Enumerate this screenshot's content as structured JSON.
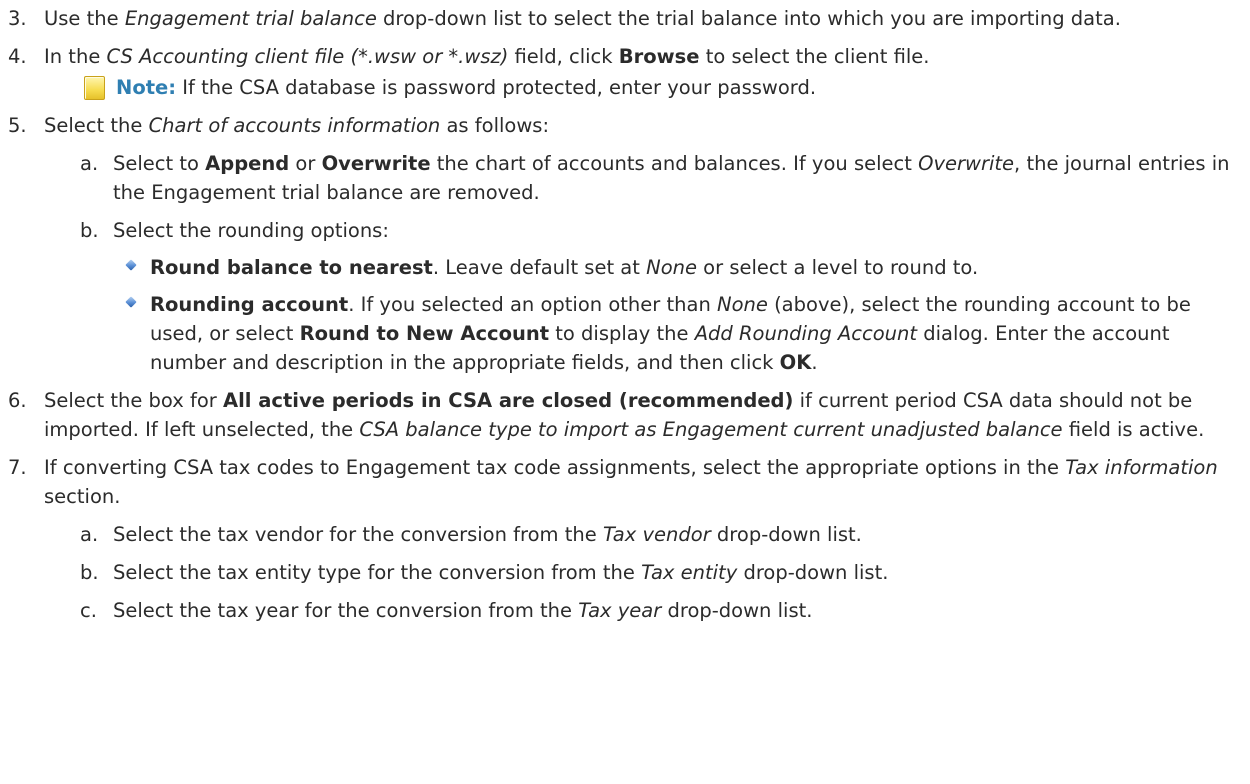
{
  "steps": [
    {
      "num": "3.",
      "segments": [
        {
          "t": "Use the ",
          "s": "n"
        },
        {
          "t": "Engagement trial balance",
          "s": "i"
        },
        {
          "t": " drop-down list to select the trial balance into which you are importing data.",
          "s": "n"
        }
      ]
    },
    {
      "num": "4.",
      "segments": [
        {
          "t": "In the ",
          "s": "n"
        },
        {
          "t": "CS Accounting client file (*.wsw or *.wsz)",
          "s": "i"
        },
        {
          "t": " field, click ",
          "s": "n"
        },
        {
          "t": "Browse",
          "s": "b"
        },
        {
          "t": " to select the client file.",
          "s": "n"
        }
      ],
      "note": {
        "icon": "note-icon",
        "label": "Note:",
        "text": " If the CSA database is password protected, enter your password."
      }
    },
    {
      "num": "5.",
      "segments": [
        {
          "t": "Select the ",
          "s": "n"
        },
        {
          "t": "Chart of accounts information",
          "s": "i"
        },
        {
          "t": " as follows:",
          "s": "n"
        }
      ],
      "subs": [
        {
          "num": "a.",
          "segments": [
            {
              "t": "Select to ",
              "s": "n"
            },
            {
              "t": "Append",
              "s": "b"
            },
            {
              "t": " or ",
              "s": "n"
            },
            {
              "t": "Overwrite",
              "s": "b"
            },
            {
              "t": " the chart of accounts and balances. If you select ",
              "s": "n"
            },
            {
              "t": "Overwrite",
              "s": "i"
            },
            {
              "t": ", the journal entries in the Engagement trial balance are removed.",
              "s": "n"
            }
          ]
        },
        {
          "num": "b.",
          "segments": [
            {
              "t": "Select the rounding options:",
              "s": "n"
            }
          ],
          "bullets": [
            {
              "segments": [
                {
                  "t": "Round balance to nearest",
                  "s": "b"
                },
                {
                  "t": ". Leave default set at ",
                  "s": "n"
                },
                {
                  "t": "None",
                  "s": "i"
                },
                {
                  "t": " or select a level to round to.",
                  "s": "n"
                }
              ]
            },
            {
              "segments": [
                {
                  "t": "Rounding account",
                  "s": "b"
                },
                {
                  "t": ". If you selected an option other than ",
                  "s": "n"
                },
                {
                  "t": "None",
                  "s": "i"
                },
                {
                  "t": " (above), select the rounding account to be used, or select ",
                  "s": "n"
                },
                {
                  "t": "Round to New Account",
                  "s": "b"
                },
                {
                  "t": " to display the ",
                  "s": "n"
                },
                {
                  "t": "Add Rounding Account",
                  "s": "i"
                },
                {
                  "t": " dialog. Enter the account number and description in the appropriate fields, and then click ",
                  "s": "n"
                },
                {
                  "t": "OK",
                  "s": "b"
                },
                {
                  "t": ".",
                  "s": "n"
                }
              ]
            }
          ]
        }
      ]
    },
    {
      "num": "6.",
      "segments": [
        {
          "t": "Select the box for ",
          "s": "n"
        },
        {
          "t": "All active periods in CSA are closed (recommended)",
          "s": "b"
        },
        {
          "t": " if current period CSA data should not be imported. If left unselected, the ",
          "s": "n"
        },
        {
          "t": "CSA balance type to import as Engagement current unadjusted balance",
          "s": "i"
        },
        {
          "t": " field is active.",
          "s": "n"
        }
      ]
    },
    {
      "num": "7.",
      "segments": [
        {
          "t": "If converting CSA tax codes to Engagement tax code assignments, select the appropriate options in the ",
          "s": "n"
        },
        {
          "t": "Tax information",
          "s": "i"
        },
        {
          "t": " section.",
          "s": "n"
        }
      ],
      "subs": [
        {
          "num": "a.",
          "segments": [
            {
              "t": "Select the tax vendor for the conversion from the ",
              "s": "n"
            },
            {
              "t": "Tax vendor",
              "s": "i"
            },
            {
              "t": " drop-down list.",
              "s": "n"
            }
          ]
        },
        {
          "num": "b.",
          "segments": [
            {
              "t": "Select the tax entity type for the conversion from the ",
              "s": "n"
            },
            {
              "t": "Tax entity",
              "s": "i"
            },
            {
              "t": " drop-down list.",
              "s": "n"
            }
          ]
        },
        {
          "num": "c.",
          "segments": [
            {
              "t": "Select the tax year for the conversion from the ",
              "s": "n"
            },
            {
              "t": "Tax year",
              "s": "i"
            },
            {
              "t": " drop-down list.",
              "s": "n"
            }
          ]
        }
      ]
    }
  ],
  "colors": {
    "note_label": "#2f7fb2",
    "bullet": "#4a7fc8",
    "text": "#2b2b2b"
  }
}
